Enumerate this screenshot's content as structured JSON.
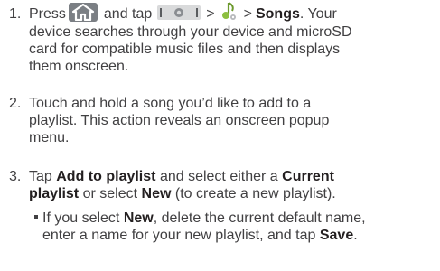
{
  "steps": [
    {
      "number": "1.",
      "pre": "Press",
      "and_tap": "and tap",
      "arrow1": ">",
      "arrow2": ">",
      "songs": "Songs",
      "post_a": ". Your",
      "line2": "device searches through your device and microSD",
      "line3": "card for compatible music files and then displays",
      "line4": "them onscreen."
    },
    {
      "number": "2.",
      "line1": "Touch and hold a song you’d like to add to a",
      "line2": "playlist. This action reveals an onscreen popup",
      "line3": "menu."
    },
    {
      "number": "3.",
      "tap": "Tap",
      "add_to_playlist": "Add to playlist",
      "select_either": "and select either a",
      "current": "Current",
      "playlist": "playlist",
      "or_select": "or select",
      "new": "New",
      "to_create": "(to create a new playlist).",
      "bullet": {
        "if_you_select": "If you select",
        "new": "New",
        "delete_text": ", delete the current default name,",
        "line2_a": "enter a name for your new playlist, and tap",
        "save": "Save",
        "period": "."
      }
    }
  ],
  "icons": {
    "home": "home-icon",
    "applications": "applications-tab-icon",
    "music": "music-icon"
  }
}
